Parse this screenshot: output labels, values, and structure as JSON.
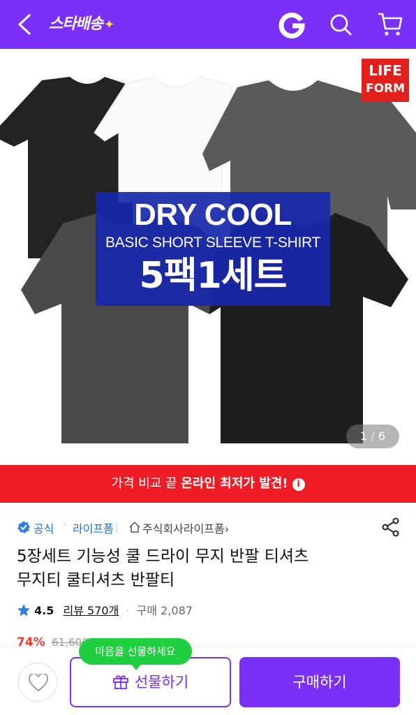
{
  "header": {
    "brand": "스타배송",
    "brand_star": "✦",
    "accent_color": "#7b2ff7",
    "icons": [
      "back-icon",
      "g-logo-icon",
      "search-icon",
      "cart-icon"
    ]
  },
  "hero": {
    "brand_badge_line1": "LIFE",
    "brand_badge_line2": "FORM",
    "promo_line1": "DRY COOL",
    "promo_line2": "BASIC SHORT SLEEVE T-SHIRT",
    "promo_line3": "5팩1세트",
    "page_current": "1",
    "page_sep": "/",
    "page_total": "6"
  },
  "banner": {
    "text_prefix": "가격 비교 끝 ",
    "text_bold": "온라인 최저가 발견!",
    "info_glyph": "i",
    "color": "#ee1c25"
  },
  "seller": {
    "official_label": "공식",
    "dot": "·",
    "store_name": "라이프폼",
    "company": "주식회사라이프폼",
    "company_chevron": "›"
  },
  "product": {
    "title_line1": "5장세트 기능성 쿨 드라이 무지 반팔 티셔츠",
    "title_line2": "무지티 쿨티셔츠 반팔티",
    "rating": "4.5",
    "reviews": "리뷰 570개",
    "sep": "·",
    "purchases": "구매 2,087",
    "discount": "74%",
    "original_price": "61,600"
  },
  "bottom_bar": {
    "tooltip": "마음을 선물하세요",
    "gift_label": "선물하기",
    "buy_label": "구매하기"
  }
}
